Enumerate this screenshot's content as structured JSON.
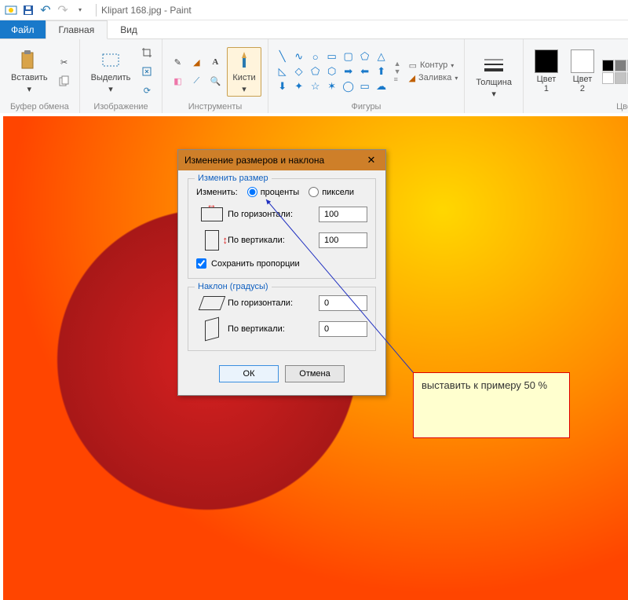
{
  "title": "Klipart 168.jpg - Paint",
  "tabs": {
    "file": "Файл",
    "home": "Главная",
    "view": "Вид"
  },
  "ribbon": {
    "clipboard": {
      "paste": "Вставить",
      "label": "Буфер обмена"
    },
    "image": {
      "select": "Выделить",
      "label": "Изображение"
    },
    "tools": {
      "brushes": "Кисти",
      "label": "Инструменты"
    },
    "shapes": {
      "outline": "Контур",
      "fill": "Заливка",
      "label": "Фигуры"
    },
    "thickness": {
      "btn": "Толщина"
    },
    "colors": {
      "c1": "Цвет\n1",
      "c2": "Цвет\n2",
      "label": "Цвета"
    }
  },
  "dialog": {
    "title": "Изменение размеров и наклона",
    "resize": {
      "legend": "Изменить размер",
      "by_label": "Изменить:",
      "percent": "проценты",
      "pixels": "пиксели",
      "horiz": "По горизонтали:",
      "vert": "По вертикали:",
      "horiz_val": "100",
      "vert_val": "100",
      "keep_ratio": "Сохранить пропорции"
    },
    "skew": {
      "legend": "Наклон (градусы)",
      "horiz": "По горизонтали:",
      "vert": "По вертикали:",
      "horiz_val": "0",
      "vert_val": "0"
    },
    "ok": "ОК",
    "cancel": "Отмена"
  },
  "annotation": "выставить к примеру 50 %",
  "palette": [
    "#000000",
    "#7f7f7f",
    "#880015",
    "#ed1c24",
    "#ff7f27",
    "#fff200",
    "#22b14c",
    "#00a2e8",
    "#3f48cc",
    "#a349a4",
    "#ffffff",
    "#c3c3c3",
    "#b97a57",
    "#ffaec9",
    "#ffc90e",
    "#efe4b0",
    "#b5e61d",
    "#99d9ea",
    "#7092be",
    "#c8bfe7"
  ]
}
